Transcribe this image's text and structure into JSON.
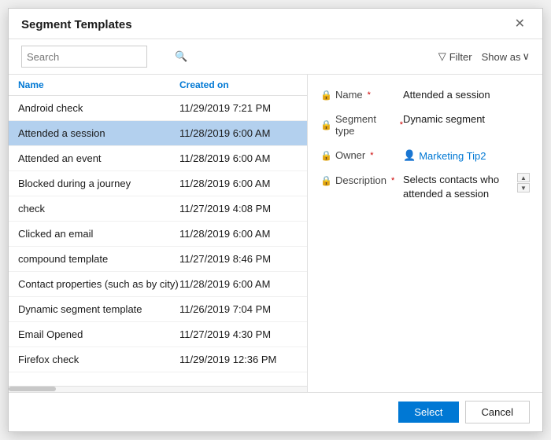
{
  "dialog": {
    "title": "Segment Templates",
    "close_label": "✕"
  },
  "toolbar": {
    "search_placeholder": "Search",
    "search_icon": "🔍",
    "filter_label": "Filter",
    "filter_icon": "▽",
    "show_as_label": "Show as",
    "show_as_icon": "∨"
  },
  "list": {
    "header_name": "Name",
    "header_date": "Created on",
    "rows": [
      {
        "name": "Android check",
        "date": "11/29/2019 7:21 PM",
        "selected": false
      },
      {
        "name": "Attended a session",
        "date": "11/28/2019 6:00 AM",
        "selected": true
      },
      {
        "name": "Attended an event",
        "date": "11/28/2019 6:00 AM",
        "selected": false
      },
      {
        "name": "Blocked during a journey",
        "date": "11/28/2019 6:00 AM",
        "selected": false
      },
      {
        "name": "check",
        "date": "11/27/2019 4:08 PM",
        "selected": false
      },
      {
        "name": "Clicked an email",
        "date": "11/28/2019 6:00 AM",
        "selected": false
      },
      {
        "name": "compound template",
        "date": "11/27/2019 8:46 PM",
        "selected": false
      },
      {
        "name": "Contact properties (such as by city)",
        "date": "11/28/2019 6:00 AM",
        "selected": false
      },
      {
        "name": "Dynamic segment template",
        "date": "11/26/2019 7:04 PM",
        "selected": false
      },
      {
        "name": "Email Opened",
        "date": "11/27/2019 4:30 PM",
        "selected": false
      },
      {
        "name": "Firefox check",
        "date": "11/29/2019 12:36 PM",
        "selected": false
      }
    ]
  },
  "detail": {
    "name_label": "Name",
    "name_value": "Attended a session",
    "segment_type_label": "Segment type",
    "segment_type_value": "Dynamic segment",
    "owner_label": "Owner",
    "owner_value": "Marketing Tip2",
    "description_label": "Description",
    "description_value": "Selects contacts who attended a session"
  },
  "footer": {
    "select_label": "Select",
    "cancel_label": "Cancel"
  }
}
